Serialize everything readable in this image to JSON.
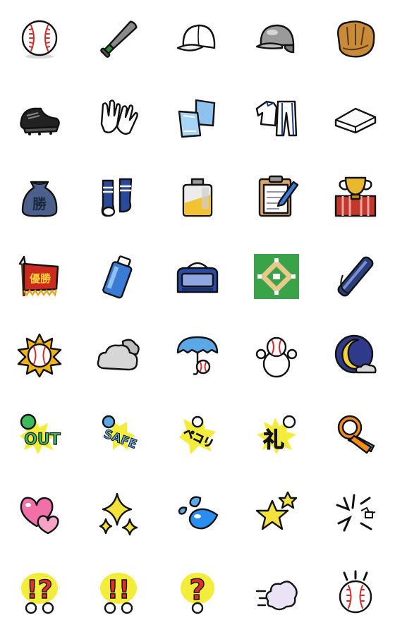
{
  "sticker_set": {
    "columns": 5,
    "rows": 8,
    "stickers": [
      {
        "icon": "baseball-icon",
        "text": ""
      },
      {
        "icon": "bat-icon",
        "text": ""
      },
      {
        "icon": "white-cap-icon",
        "text": ""
      },
      {
        "icon": "batting-helmet-icon",
        "text": ""
      },
      {
        "icon": "glove-icon",
        "text": ""
      },
      {
        "icon": "cleats-icon",
        "text": ""
      },
      {
        "icon": "batting-gloves-icon",
        "text": ""
      },
      {
        "icon": "towels-icon",
        "text": ""
      },
      {
        "icon": "uniform-icon",
        "text": ""
      },
      {
        "icon": "base-icon",
        "text": ""
      },
      {
        "icon": "win-bag-icon",
        "text": "勝"
      },
      {
        "icon": "socks-icon",
        "text": ""
      },
      {
        "icon": "flask-icon",
        "text": ""
      },
      {
        "icon": "clipboard-icon",
        "text": ""
      },
      {
        "icon": "trophy-icon",
        "text": ""
      },
      {
        "icon": "championship-flag-icon",
        "text": "優勝"
      },
      {
        "icon": "spray-can-icon",
        "text": ""
      },
      {
        "icon": "sports-bag-icon",
        "text": ""
      },
      {
        "icon": "baseball-diamond-icon",
        "text": ""
      },
      {
        "icon": "bat-case-icon",
        "text": ""
      },
      {
        "icon": "sun-ball-icon",
        "text": ""
      },
      {
        "icon": "cloud-icon",
        "text": ""
      },
      {
        "icon": "rain-umbrella-icon",
        "text": ""
      },
      {
        "icon": "snowman-icon",
        "text": ""
      },
      {
        "icon": "moon-icon",
        "text": ""
      },
      {
        "icon": "out-text-icon",
        "text": "OUT"
      },
      {
        "icon": "safe-text-icon",
        "text": "SAFE"
      },
      {
        "icon": "bow-text-icon",
        "text": "ペコリ"
      },
      {
        "icon": "thanks-text-icon",
        "text": "礼"
      },
      {
        "icon": "ok-sign-icon",
        "text": ""
      },
      {
        "icon": "hearts-icon",
        "text": ""
      },
      {
        "icon": "sparkles-icon",
        "text": ""
      },
      {
        "icon": "sweat-drops-icon",
        "text": ""
      },
      {
        "icon": "stars-icon",
        "text": ""
      },
      {
        "icon": "anger-icon",
        "text": ""
      },
      {
        "icon": "exclaim-question-icon",
        "text": "!?"
      },
      {
        "icon": "double-exclaim-icon",
        "text": "!!"
      },
      {
        "icon": "question-icon",
        "text": "?"
      },
      {
        "icon": "dash-puff-icon",
        "text": ""
      },
      {
        "icon": "surprise-ball-icon",
        "text": ""
      }
    ]
  }
}
